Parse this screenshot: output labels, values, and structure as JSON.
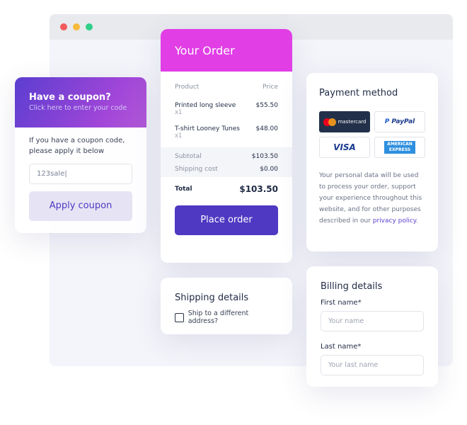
{
  "colors": {
    "brand": "#4f38c2",
    "order_header": "#e13ee6"
  },
  "coupon": {
    "title": "Have a coupon?",
    "subtitle": "Click here to enter your code",
    "instructions": "If you have a coupon code, please apply it below",
    "input_value": "123sale",
    "button": "Apply coupon"
  },
  "order": {
    "title": "Your Order",
    "col_product": "Product",
    "col_price": "Price",
    "items": [
      {
        "name": "Printed long sleeve",
        "qty": "x1",
        "price": "$55.50"
      },
      {
        "name": "T-shirt Looney Tunes",
        "qty": "x1",
        "price": "$48.00"
      }
    ],
    "subtotal_label": "Subtotal",
    "subtotal": "$103.50",
    "shipping_label": "Shipping cost",
    "shipping": "$0.00",
    "total_label": "Total",
    "total": "$103.50",
    "button": "Place order"
  },
  "shipping": {
    "title": "Shipping details",
    "checkbox_label": "Ship to a different address?",
    "checked": false
  },
  "payment": {
    "title": "Payment method",
    "methods": [
      "mastercard",
      "PayPal",
      "VISA",
      "AMERICAN EXPRESS"
    ],
    "text": "Your personal data will be used to process your order, support your experience throughout this website, and for other purposes described in our ",
    "link": "privacy policy",
    "end": "."
  },
  "billing": {
    "title": "Billing details",
    "first_label": "First name*",
    "first_placeholder": "Your name",
    "last_label": "Last name*",
    "last_placeholder": "Your last name"
  }
}
